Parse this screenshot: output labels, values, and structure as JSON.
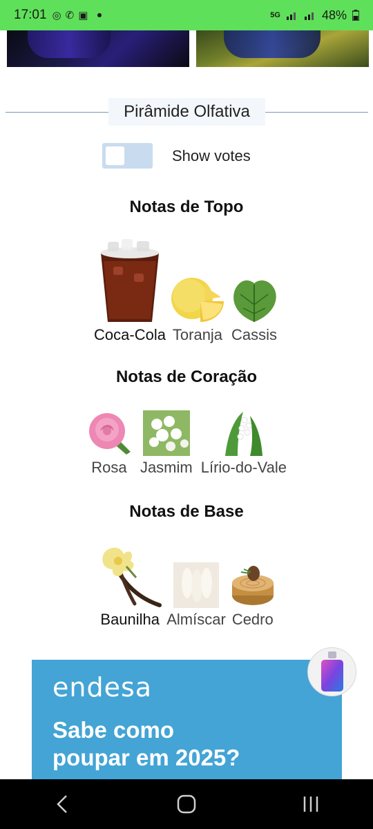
{
  "status_bar": {
    "time": "17:01",
    "network": "5G",
    "battery": "48%"
  },
  "section_title": "Pirâmide Olfativa",
  "toggle": {
    "label": "Show votes",
    "state": "off"
  },
  "top_notes": {
    "title": "Notas de Topo",
    "items": [
      {
        "label": "Coca-Cola"
      },
      {
        "label": "Toranja"
      },
      {
        "label": "Cassis"
      }
    ]
  },
  "heart_notes": {
    "title": "Notas de Coração",
    "items": [
      {
        "label": "Rosa"
      },
      {
        "label": "Jasmim"
      },
      {
        "label": "Lírio-do-Vale"
      }
    ]
  },
  "base_notes": {
    "title": "Notas de Base",
    "items": [
      {
        "label": "Baunilha"
      },
      {
        "label": "Almíscar"
      },
      {
        "label": "Cedro"
      }
    ]
  },
  "ad": {
    "brand": "endesa",
    "headline_line1": "Sabe como",
    "headline_line2": "poupar em 2025?",
    "background_color": "#43a4d5"
  },
  "colors": {
    "status_bar": "#5fe05a",
    "divider": "#7b96b8",
    "toggle_track": "#c9dcef"
  }
}
